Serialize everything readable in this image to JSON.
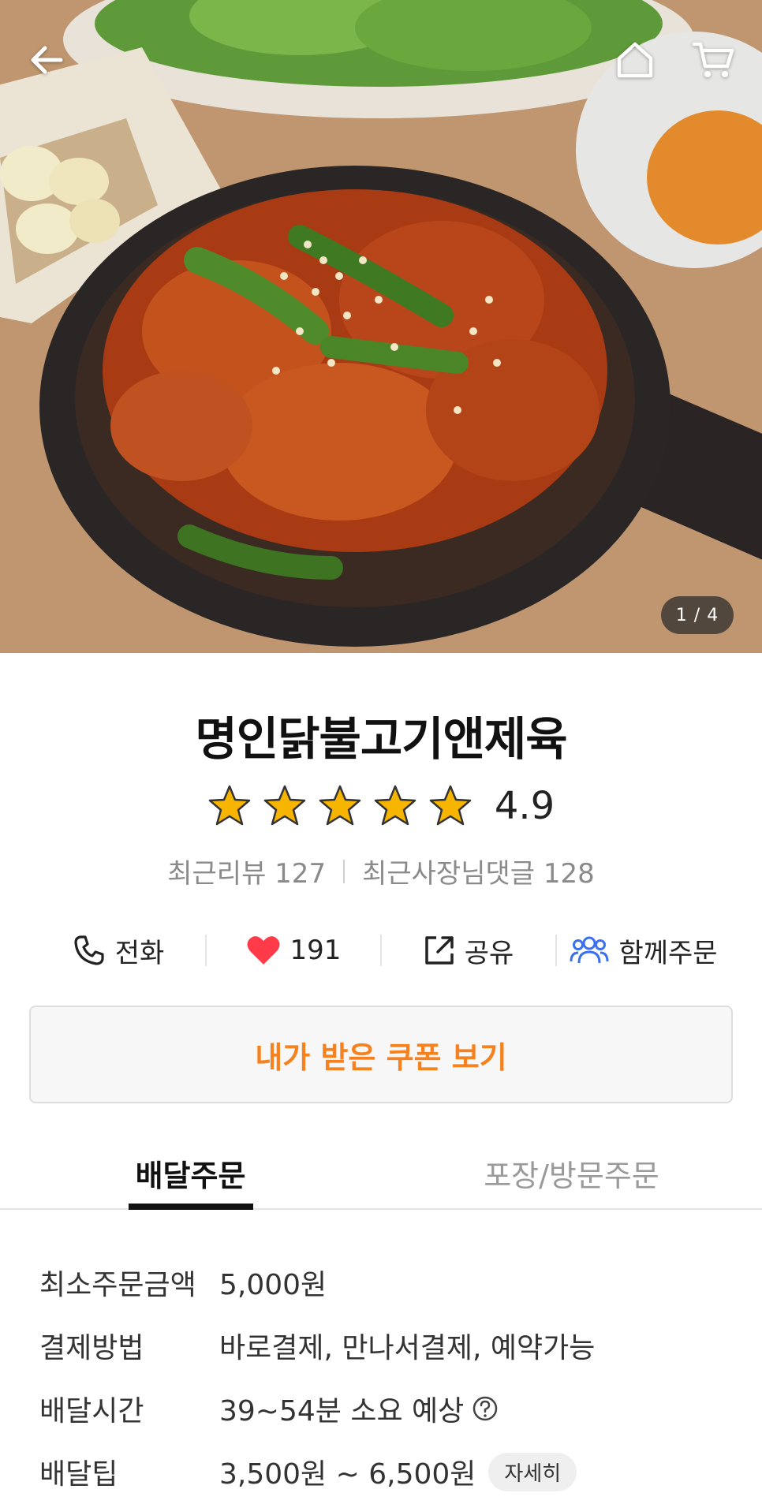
{
  "header": {
    "back_icon": "arrow-left-icon",
    "home_icon": "home-icon",
    "cart_icon": "cart-icon",
    "photo_indicator": "1 / 4"
  },
  "store": {
    "name": "명인닭불고기앤제육",
    "rating": "4.9",
    "rating_stars": 5,
    "recent_reviews": "최근리뷰 127",
    "recent_owner_replies": "최근사장님댓글 128"
  },
  "actions": {
    "call_label": "전화",
    "like_count": "191",
    "share_label": "공유",
    "group_order_label": "함께주문"
  },
  "coupon": {
    "label": "내가 받은 쿠폰 보기"
  },
  "tabs": [
    {
      "label": "배달주문",
      "active": true
    },
    {
      "label": "포장/방문주문",
      "active": false
    }
  ],
  "info": {
    "min_order_label": "최소주문금액",
    "min_order_value": "5,000원",
    "payment_label": "결제방법",
    "payment_value": "바로결제, 만나서결제, 예약가능",
    "delivery_time_label": "배달시간",
    "delivery_time_value": "39~54분 소요 예상",
    "delivery_tip_label": "배달팁",
    "delivery_tip_value": "3,500원 ~ 6,500원",
    "detail_button": "자세히"
  },
  "colors": {
    "accent_orange": "#f5821f",
    "heart_red": "#ff3b4a",
    "group_blue": "#3a6ff0",
    "star_gold": "#f7b500"
  }
}
